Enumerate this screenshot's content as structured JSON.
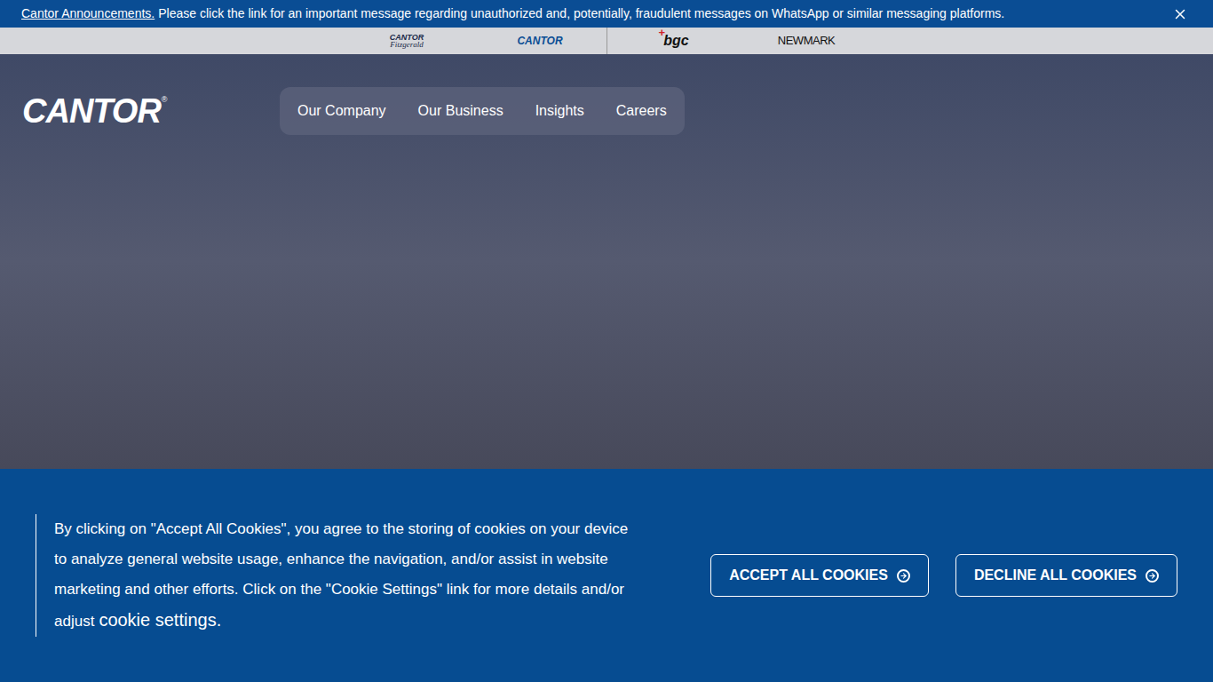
{
  "announcement": {
    "link": "Cantor Announcements.",
    "message": "Please click the link for an important message regarding unauthorized and, potentially, fraudulent messages on WhatsApp or similar messaging platforms."
  },
  "brands": [
    {
      "name": "CANTOR",
      "sub": "Fitzgerald",
      "kind": "fitzgerald"
    },
    {
      "name": "CANTOR",
      "sub": "",
      "kind": "cantor"
    },
    {
      "name": "bgc",
      "sub": "",
      "kind": "bgc"
    },
    {
      "name": "NEWMARK",
      "sub": "",
      "kind": "newmark"
    }
  ],
  "logo": {
    "text": "CANTOR",
    "mark": "®"
  },
  "nav": [
    {
      "label": "Our Company"
    },
    {
      "label": "Our Business"
    },
    {
      "label": "Insights"
    },
    {
      "label": "Careers"
    }
  ],
  "cookie": {
    "text": "By clicking on \"Accept All Cookies\", you agree to the storing of cookies on your device to analyze general website usage, enhance the navigation, and/or assist in website marketing and other efforts. Click on the \"Cookie Settings\" link for more details and/or adjust",
    "link": "cookie settings.",
    "buttons": [
      "ACCEPT ALL COOKIES",
      "DECLINE ALL COOKIES"
    ]
  }
}
